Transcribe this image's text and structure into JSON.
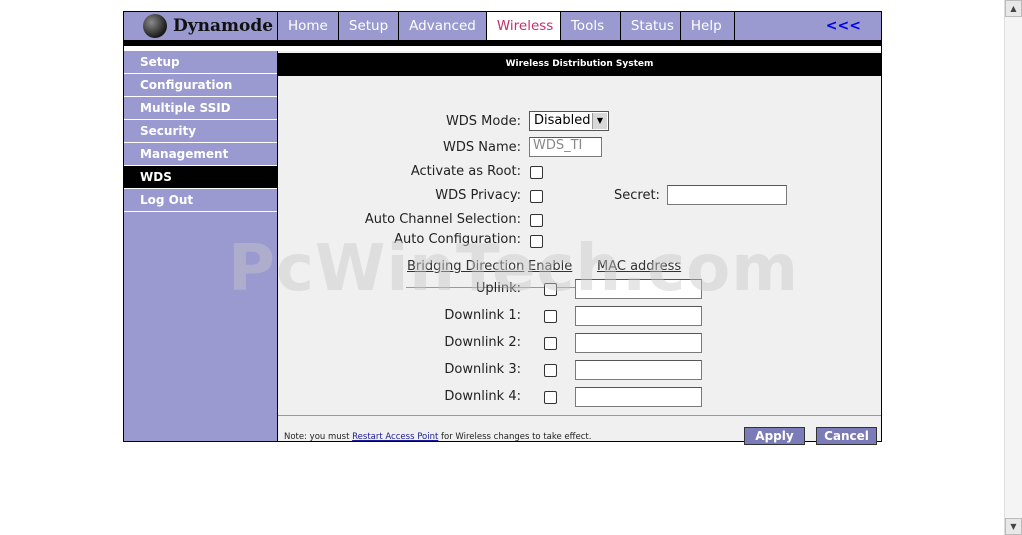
{
  "header": {
    "logo_text": "Dynamode",
    "nav": [
      "Home",
      "Setup",
      "Advanced",
      "Wireless",
      "Tools",
      "Status",
      "Help"
    ],
    "active_nav": "Wireless",
    "back_link": "<<<"
  },
  "sidebar": {
    "items": [
      "Setup",
      "Configuration",
      "Multiple SSID",
      "Security",
      "Management",
      "WDS",
      "Log Out"
    ],
    "active": "WDS"
  },
  "main": {
    "section_title": "Wireless Distribution System",
    "wds_mode_label": "WDS Mode:",
    "wds_mode_value": "Disabled",
    "wds_name_label": "WDS Name:",
    "wds_name_value": "WDS_TI",
    "activate_root_label": "Activate as Root:",
    "wds_privacy_label": "WDS Privacy:",
    "secret_label": "Secret:",
    "auto_channel_label": "Auto Channel Selection:",
    "auto_config_label": "Auto Configuration:",
    "col_bridging": "Bridging Direction",
    "col_enable": "Enable",
    "col_mac": "MAC address",
    "links": [
      "Uplink:",
      "Downlink 1:",
      "Downlink 2:",
      "Downlink 3:",
      "Downlink 4:"
    ],
    "note_prefix": "Note: you must ",
    "note_link": "Restart Access Point",
    "note_suffix": " for Wireless changes to take effect.",
    "apply_label": "Apply",
    "cancel_label": "Cancel",
    "watermark": "PcWinTech.com"
  },
  "colors": {
    "nav_bg": "#9a9ad0",
    "active_nav_text": "#c0306e",
    "button_bg": "#7b7bb8"
  },
  "icons": {
    "logo": "sphere-logo-icon",
    "dropdown": "chevron-down-icon",
    "scroll_up": "scroll-up-icon",
    "scroll_down": "scroll-down-icon"
  }
}
